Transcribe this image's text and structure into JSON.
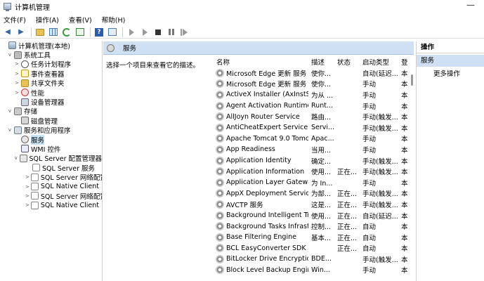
{
  "window": {
    "title": "计算机管理"
  },
  "menu": [
    "文件(F)",
    "操作(A)",
    "查看(V)",
    "帮助(H)"
  ],
  "toolbar": {
    "icons": [
      "back-arrow-icon",
      "forward-arrow-icon",
      "folder-icon",
      "grid-icon",
      "refresh-icon",
      "export-icon",
      "help-icon",
      "properties-icon",
      "start-service-icon",
      "start-service-alt-icon",
      "stop-service-icon",
      "pause-service-icon",
      "restart-service-icon"
    ]
  },
  "tree": [
    {
      "label": "计算机管理(本地)",
      "icon": "computer-icon",
      "level": 0,
      "expander": ""
    },
    {
      "label": "系统工具",
      "icon": "tools-icon",
      "level": 1,
      "expander": "v"
    },
    {
      "label": "任务计划程序",
      "icon": "clock-icon",
      "level": 2,
      "expander": ">"
    },
    {
      "label": "事件查看器",
      "icon": "event-viewer-icon",
      "level": 2,
      "expander": ">"
    },
    {
      "label": "共享文件夹",
      "icon": "shared-folder-icon",
      "level": 2,
      "expander": ">"
    },
    {
      "label": "性能",
      "icon": "performance-icon",
      "level": 2,
      "expander": ">"
    },
    {
      "label": "设备管理器",
      "icon": "device-manager-icon",
      "level": 2,
      "expander": ""
    },
    {
      "label": "存储",
      "icon": "storage-icon",
      "level": 1,
      "expander": "v"
    },
    {
      "label": "磁盘管理",
      "icon": "disk-icon",
      "level": 2,
      "expander": ""
    },
    {
      "label": "服务和应用程序",
      "icon": "services-apps-icon",
      "level": 1,
      "expander": "v"
    },
    {
      "label": "服务",
      "icon": "gear-icon",
      "level": 2,
      "expander": "",
      "selected": true
    },
    {
      "label": "WMI 控件",
      "icon": "wmi-icon",
      "level": 2,
      "expander": ""
    },
    {
      "label": "SQL Server 配置管理器",
      "icon": "sql-server-icon",
      "level": 2,
      "expander": "v"
    },
    {
      "label": "SQL Server 服务",
      "icon": "sql-service-icon",
      "level": 3,
      "expander": ""
    },
    {
      "label": "SQL Server 网络配置",
      "icon": "sql-network-icon",
      "level": 3,
      "expander": ">"
    },
    {
      "label": "SQL Native Client 1",
      "icon": "sql-client-icon",
      "level": 3,
      "expander": ">"
    },
    {
      "label": "SQL Server 网络配置",
      "icon": "sql-network-icon",
      "level": 3,
      "expander": ">"
    },
    {
      "label": "SQL Native Client 1",
      "icon": "sql-client-icon",
      "level": 3,
      "expander": ">"
    }
  ],
  "center": {
    "header_title": "服务",
    "description": "选择一个项目来查看它的描述。",
    "columns": {
      "name": "名称",
      "desc": "描述",
      "status": "状态",
      "startup": "启动类型",
      "logon": "登"
    },
    "services": [
      {
        "name": "Microsoft Edge 更新 服务 (...",
        "desc": "使你...",
        "status": "",
        "startup": "自动(延迟...",
        "logon": "本"
      },
      {
        "name": "Microsoft Edge 更新 服务 (...",
        "desc": "使你...",
        "status": "",
        "startup": "手动",
        "logon": "本"
      },
      {
        "name": "ActiveX Installer (AxInstSV)",
        "desc": "为从 ...",
        "status": "",
        "startup": "手动",
        "logon": "本"
      },
      {
        "name": "Agent Activation Runtime_...",
        "desc": "Runt...",
        "status": "",
        "startup": "手动",
        "logon": "本"
      },
      {
        "name": "AllJoyn Router Service",
        "desc": "路由...",
        "status": "",
        "startup": "手动(触发...",
        "logon": "本"
      },
      {
        "name": "AntiCheatExpert Service",
        "desc": "Servi...",
        "status": "",
        "startup": "手动(触发...",
        "logon": "本"
      },
      {
        "name": "Apache Tomcat 9.0 Tomcat9",
        "desc": "Apac...",
        "status": "",
        "startup": "手动",
        "logon": "本"
      },
      {
        "name": "App Readiness",
        "desc": "当用...",
        "status": "",
        "startup": "手动",
        "logon": "本"
      },
      {
        "name": "Application Identity",
        "desc": "确定...",
        "status": "",
        "startup": "手动(触发...",
        "logon": "本"
      },
      {
        "name": "Application Information",
        "desc": "使用...",
        "status": "正在...",
        "startup": "手动(触发...",
        "logon": "本"
      },
      {
        "name": "Application Layer Gateway ...",
        "desc": "为 In...",
        "status": "",
        "startup": "手动",
        "logon": "本"
      },
      {
        "name": "AppX Deployment Service ...",
        "desc": "为部...",
        "status": "正在...",
        "startup": "手动(触发...",
        "logon": "本"
      },
      {
        "name": "AVCTP 服务",
        "desc": "这是...",
        "status": "正在...",
        "startup": "手动(触发...",
        "logon": "本"
      },
      {
        "name": "Background Intelligent Tra...",
        "desc": "使用...",
        "status": "正在...",
        "startup": "自动(延迟...",
        "logon": "本"
      },
      {
        "name": "Background Tasks Infrastru...",
        "desc": "控制...",
        "status": "正在...",
        "startup": "自动",
        "logon": "本"
      },
      {
        "name": "Base Filtering Engine",
        "desc": "基本...",
        "status": "正在...",
        "startup": "自动",
        "logon": "本"
      },
      {
        "name": "BCL EasyConverter SDK 4 L...",
        "desc": "",
        "status": "正在...",
        "startup": "自动",
        "logon": "本"
      },
      {
        "name": "BitLocker Drive Encryption ...",
        "desc": "BDE...",
        "status": "",
        "startup": "手动(触发...",
        "logon": "本"
      },
      {
        "name": "Block Level Backup Engine ...",
        "desc": "Win...",
        "status": "",
        "startup": "手动",
        "logon": "本"
      }
    ]
  },
  "actions": {
    "title": "操作",
    "section": "服务",
    "item": "更多操作"
  }
}
